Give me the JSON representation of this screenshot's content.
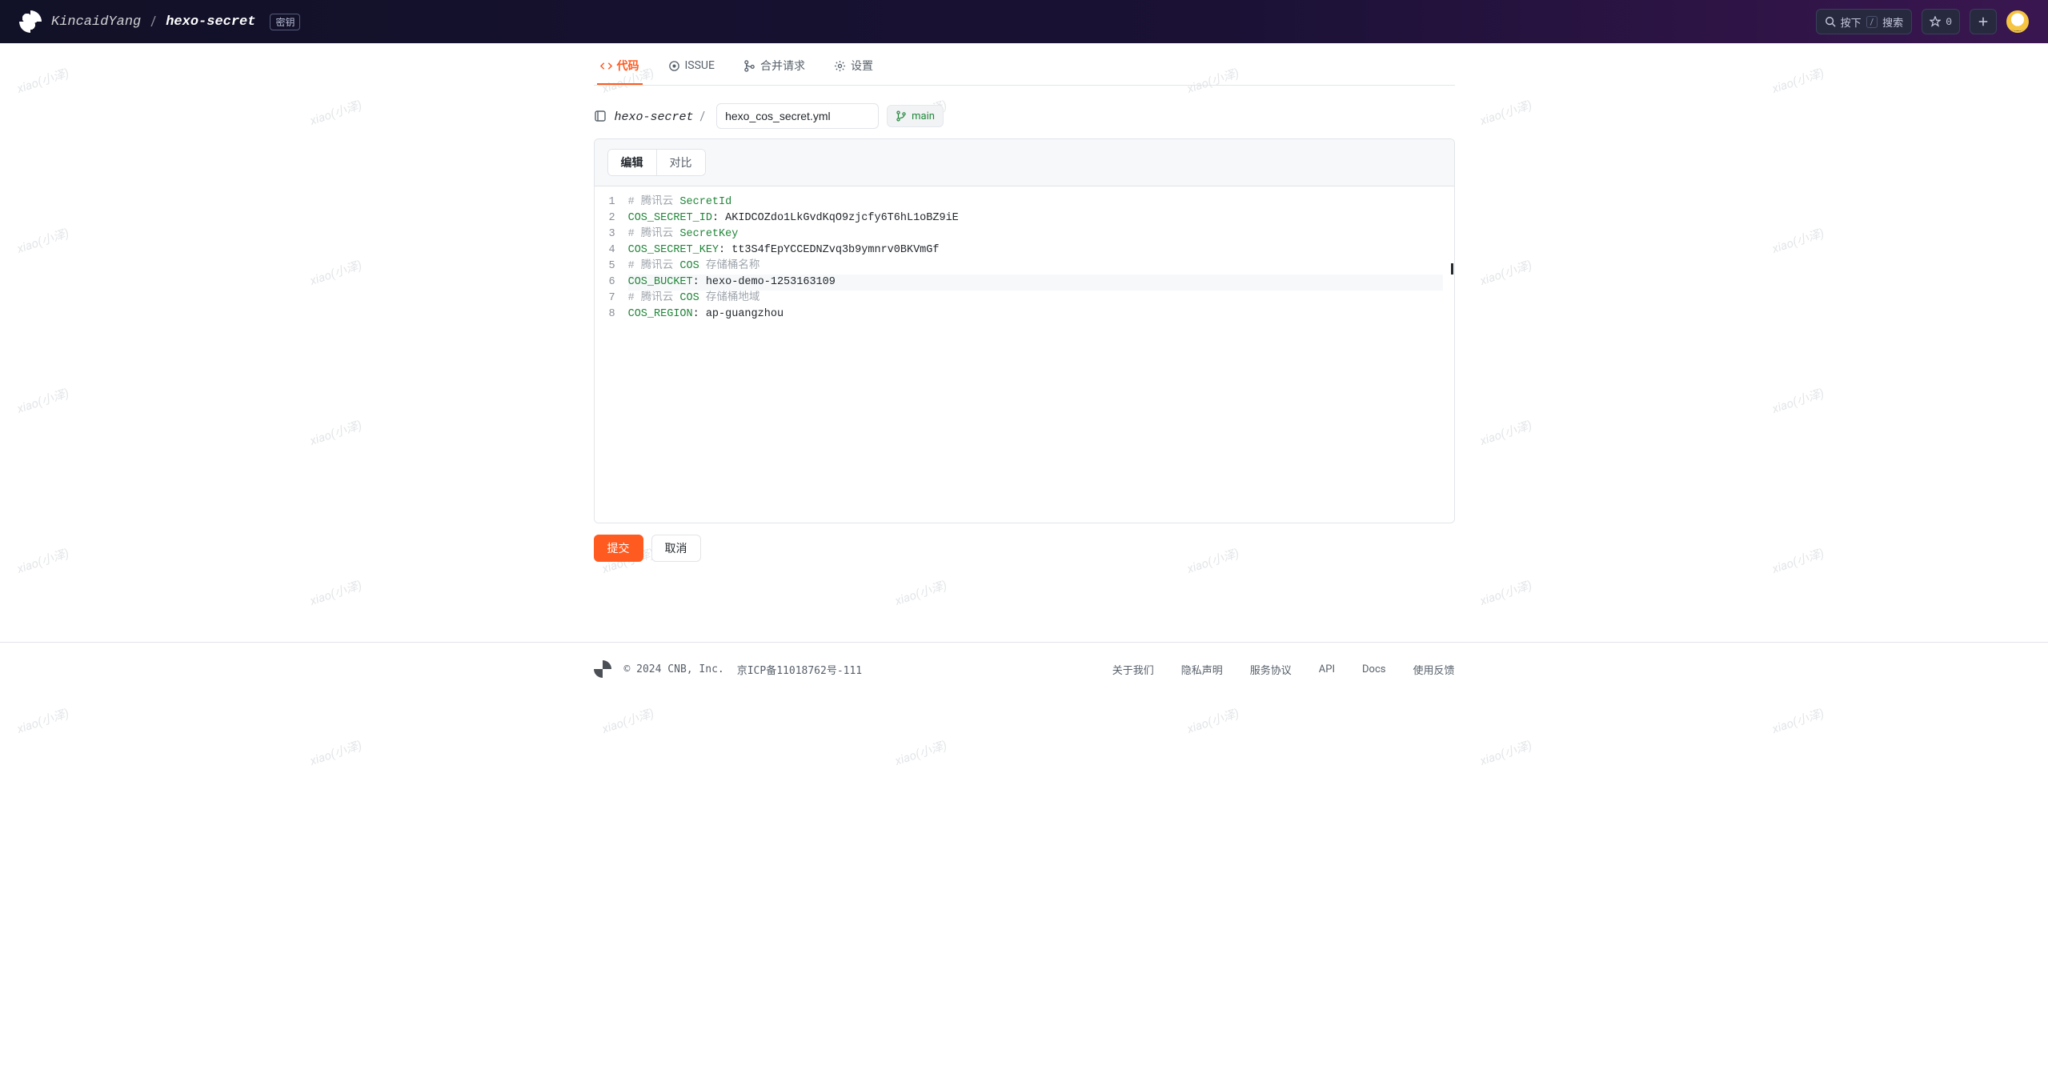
{
  "watermark_text": "xiao(小泽)",
  "header": {
    "owner": "KincaidYang",
    "repo": "hexo-secret",
    "secret_badge": "密钥",
    "search_hint_left": "按下",
    "search_kbd": "/",
    "search_hint_right": "搜索",
    "star_count": "0"
  },
  "tabs": {
    "code": "代码",
    "issue": "ISSUE",
    "merge": "合并请求",
    "settings": "设置"
  },
  "breadcrumb": {
    "repo": "hexo-secret",
    "sep": "/",
    "filename": "hexo_cos_secret.yml",
    "branch": "main"
  },
  "editor_tabs": {
    "edit": "编辑",
    "diff": "对比"
  },
  "code": {
    "lines": [
      {
        "n": 1,
        "kind": "comment",
        "pre": "# 腾讯云 ",
        "strong": "SecretId",
        "post": ""
      },
      {
        "n": 2,
        "kind": "kv",
        "key": "COS_SECRET_ID",
        "value": "AKIDCOZdo1LkGvdKqO9zjcfy6T6hL1oBZ9iE"
      },
      {
        "n": 3,
        "kind": "comment",
        "pre": "# 腾讯云 ",
        "strong": "SecretKey",
        "post": ""
      },
      {
        "n": 4,
        "kind": "kv",
        "key": "COS_SECRET_KEY",
        "value": "tt3S4fEpYCCEDNZvq3b9ymnrv0BKVmGf"
      },
      {
        "n": 5,
        "kind": "comment",
        "pre": "# 腾讯云 ",
        "strong": "COS",
        "post": " 存储桶名称"
      },
      {
        "n": 6,
        "kind": "kv",
        "key": "COS_BUCKET",
        "value": "hexo-demo-1253163109",
        "highlight": true
      },
      {
        "n": 7,
        "kind": "comment",
        "pre": "# 腾讯云 ",
        "strong": "COS",
        "post": " 存储桶地域"
      },
      {
        "n": 8,
        "kind": "kv",
        "key": "COS_REGION",
        "value": "ap-guangzhou"
      }
    ]
  },
  "actions": {
    "submit": "提交",
    "cancel": "取消"
  },
  "footer": {
    "copyright": "© 2024 CNB, Inc.",
    "icp": "京ICP备11018762号-111",
    "links": {
      "about": "关于我们",
      "privacy": "隐私声明",
      "terms": "服务协议",
      "api": "API",
      "docs": "Docs",
      "feedback": "使用反馈"
    }
  }
}
